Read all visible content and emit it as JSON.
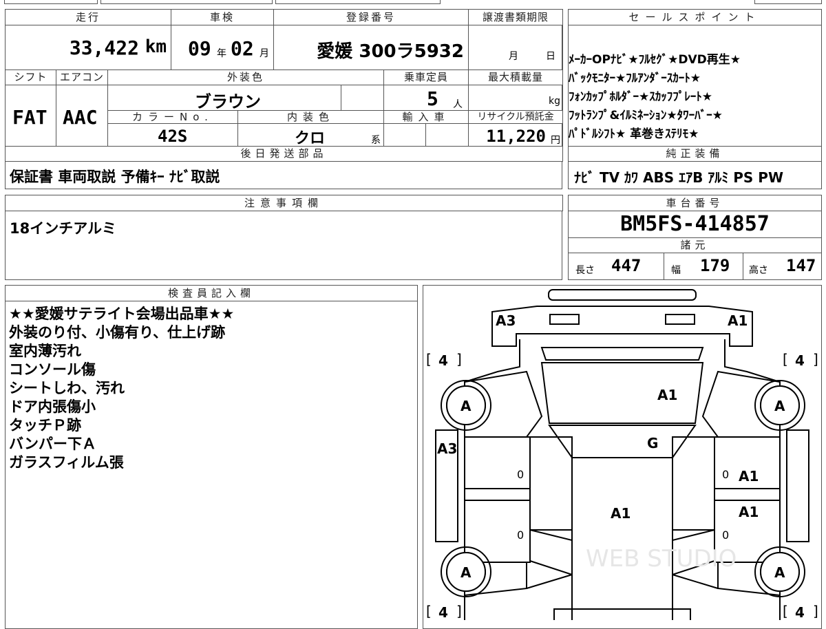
{
  "headers": {
    "mileage": "走行",
    "inspection": "車検",
    "reg_number": "登録番号",
    "transfer_deadline": "譲渡書類期限",
    "sales_points": "セールスポイント",
    "shift": "シフト",
    "aircon": "エアコン",
    "exterior_color": "外装色",
    "capacity": "乗車定員",
    "max_load": "最大積載量",
    "color_no": "カラーNo.",
    "interior_color": "内装色",
    "import": "輸入車",
    "recycle_fee": "リサイクル預託金",
    "later_parts": "後日発送部品",
    "genuine_equipment": "純正装備",
    "caution": "注意事項欄",
    "chassis_number": "車台番号",
    "specs": "諸元",
    "inspector": "検査員記入欄"
  },
  "values": {
    "mileage": "33,422",
    "mileage_unit": "km",
    "insp_year": "09",
    "year_unit": "年",
    "insp_month": "02",
    "month_unit": "月",
    "reg_number": "愛媛 300ラ5932",
    "deadline_month": "月",
    "deadline_day": "日",
    "shift": "FAT",
    "aircon": "AAC",
    "exterior_color": "ブラウン",
    "capacity": "5",
    "capacity_unit": "人",
    "max_load_unit": "kg",
    "color_no": "42S",
    "interior_color": "クロ",
    "interior_suffix": "系",
    "recycle_fee": "11,220",
    "recycle_unit": "円",
    "later_parts": "保証書 車両取説 予備ｷｰ ﾅﾋﾞ取説",
    "genuine_equipment": "ﾅﾋﾞ TV ｶﾜ ABS ｴｱB ｱﾙﾐ PS PW",
    "caution": "18インチアルミ",
    "chassis_number": "BM5FS-414857",
    "length_label": "長さ",
    "length": "447",
    "width_label": "幅",
    "width": "179",
    "height_label": "高さ",
    "height": "147"
  },
  "sales_points": [
    "ﾒｰｶｰOPﾅﾋﾞ★ﾌﾙｾｸﾞ★DVD再生★",
    "ﾊﾞｯｸﾓﾆﾀｰ★ﾌﾙｱﾝﾀﾞｰｽｶｰﾄ★",
    "ﾌｫﾝｶｯﾌﾟﾎﾙﾀﾞｰ★ｽｶｯﾌﾌﾟﾚｰﾄ★",
    "ﾌｯﾄﾗﾝﾌﾟ&ｲﾙﾐﾈｰｼｮﾝ★ﾀﾜｰﾊﾞｰ★",
    "ﾊﾟﾄﾞﾙｼﾌﾄ★ 革巻きｽﾃﾘﾓ★"
  ],
  "inspector_notes": [
    "★★愛媛サテライト会場出品車★★",
    "外装のり付、小傷有り、仕上げ跡",
    "室内薄汚れ",
    "コンソール傷",
    "シートしわ、汚れ",
    "ドア内張傷小",
    "タッチＰ跡",
    "バンパー下Ａ",
    "ガラスフィルム張"
  ],
  "diagram": {
    "marks": {
      "front_left": "A3",
      "front_right": "A1",
      "hood": "A1",
      "windshield": "G",
      "left_fender": "A3",
      "right_front_door": "A1",
      "right_rear_door": "A1",
      "roof": "A1",
      "wheel_fl": "A",
      "wheel_fr": "A",
      "wheel_rl": "A",
      "wheel_rr": "A",
      "left_front_door_num": "0",
      "left_rear_door_num": "0",
      "right_front_door_num": "0",
      "right_rear_door_num": "0"
    },
    "tires": {
      "fl": "4",
      "fr": "4",
      "rl": "4",
      "rr": "4"
    },
    "watermark": "WEB STUDIO"
  }
}
